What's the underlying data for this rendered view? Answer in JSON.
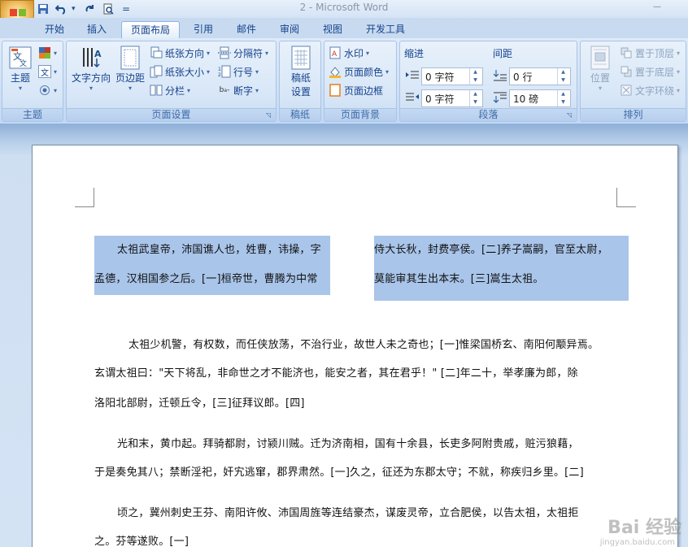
{
  "window": {
    "title": "2 - Microsoft Word",
    "minimize_glyph": "—"
  },
  "qat": {
    "save_icon": "save-icon",
    "undo_icon": "undo-icon",
    "redo_icon": "redo-icon",
    "print_preview_icon": "print-preview-icon",
    "customize_icon": "customize-qat-icon",
    "customize_glyph": "="
  },
  "tabs": [
    {
      "label": "开始"
    },
    {
      "label": "插入"
    },
    {
      "label": "页面布局"
    },
    {
      "label": "引用"
    },
    {
      "label": "邮件"
    },
    {
      "label": "审阅"
    },
    {
      "label": "视图"
    },
    {
      "label": "开发工具"
    }
  ],
  "ribbon": {
    "theme_group": {
      "label": "主题",
      "theme_button": "主题"
    },
    "page_setup": {
      "label": "页面设置",
      "text_direction": "文字方向",
      "margins": "页边距",
      "orientation": "纸张方向",
      "size": "纸张大小",
      "columns": "分栏",
      "breaks": "分隔符",
      "line_numbers": "行号",
      "hyphenation": "断字"
    },
    "manuscript": {
      "label": "稿纸",
      "settings_line1": "稿纸",
      "settings_line2": "设置"
    },
    "page_background": {
      "label": "页面背景",
      "watermark": "水印",
      "page_color": "页面颜色",
      "page_borders": "页面边框"
    },
    "paragraph": {
      "label": "段落",
      "indent_title": "缩进",
      "spacing_title": "间距",
      "indent_left": "0 字符",
      "indent_right": "0 字符",
      "spacing_before": "0 行",
      "spacing_after": "10 磅"
    },
    "arrange": {
      "label": "排列",
      "position": "位置",
      "bring_front": "置于顶层",
      "send_back": "置于底层",
      "text_wrap": "文字环绕"
    }
  },
  "document": {
    "col1_line1": "太祖武皇帝，沛国谯人也，姓曹，讳操，字",
    "col1_line2": "孟德，汉相国参之后。[一]桓帝世，曹腾为中常",
    "col2_line1": "侍大长秋，封费亭侯。[二]养子嵩嗣，官至太尉，",
    "col2_line2": "莫能审其生出本末。[三]嵩生太祖。",
    "p2_line1": "太祖少机警，有权数，而任侠放荡，不治行业，故世人未之奇也；[一]惟梁国桥玄、南阳何颙异焉。",
    "p2_line2": "玄谓太祖曰：\"天下将乱，非命世之才不能济也，能安之者，其在君乎！\"  [二]年二十，举孝廉为郎，除",
    "p2_line3": "洛阳北部尉，迁顿丘令，[三]征拜议郎。[四]",
    "p3_line1": "光和末，黄巾起。拜骑都尉，讨颍川贼。迁为济南相，国有十余县，长吏多阿附贵戚，赃污狼藉，",
    "p3_line2": "于是奏免其八；禁断淫祀，奸宄逃窜，郡界肃然。[一]久之，征还为东郡太守；不就，称疾归乡里。[二]",
    "p4_line1": "顷之，冀州刺史王芬、南阳许攸、沛国周旌等连结豪杰，谋废灵帝，立合肥侯，以告太祖，太祖拒",
    "p4_line2": "之。芬等遂败。[一]"
  },
  "watermark": {
    "text": "Bai 经验",
    "sub": "jingyan.baidu.com"
  },
  "colors": {
    "selection": "#a9c5ea",
    "ribbon_text": "#15428b",
    "tab_bar": "#c7daf0"
  }
}
